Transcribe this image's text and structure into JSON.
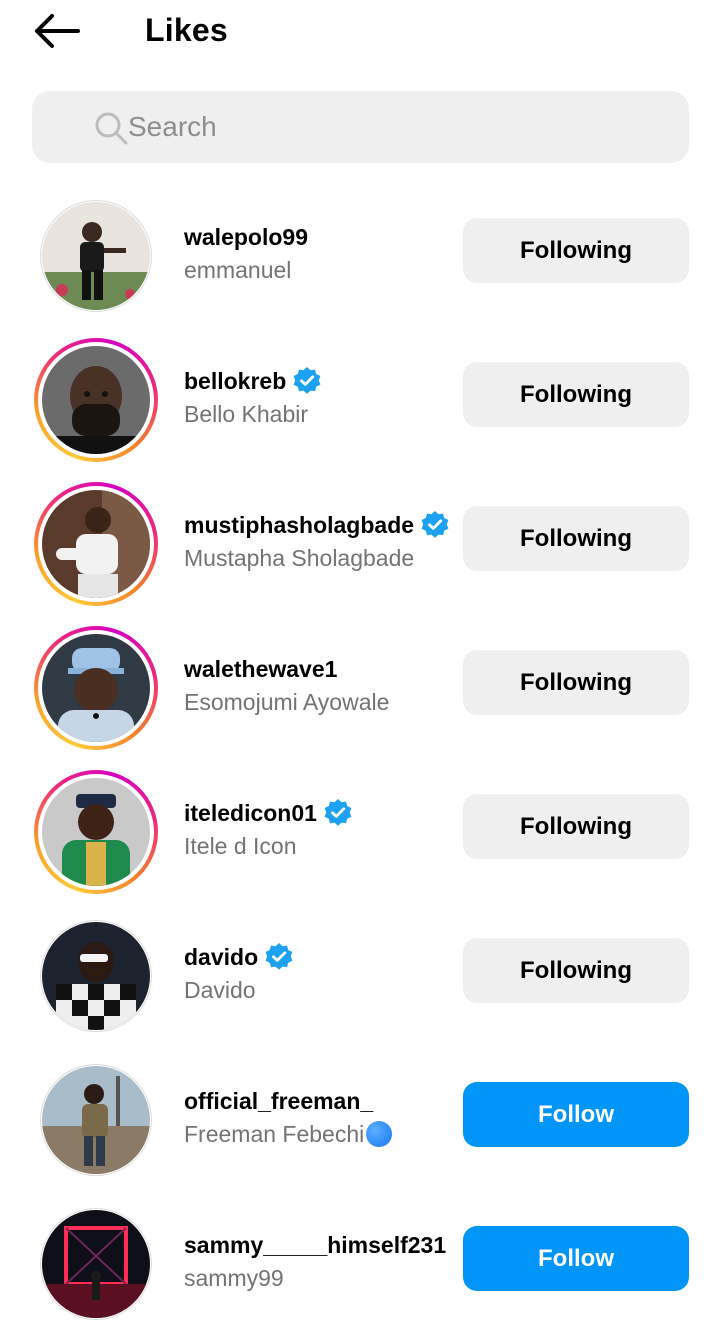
{
  "header": {
    "title": "Likes",
    "back_icon": "arrow-left-icon"
  },
  "search": {
    "placeholder": "Search",
    "icon": "search-icon"
  },
  "colors": {
    "follow_blue": "#0095f6",
    "verified_blue": "#1da1f2",
    "button_gray": "#efefef",
    "secondary_text": "#737373"
  },
  "users": [
    {
      "username": "walepolo99",
      "full_name": "emmanuel",
      "verified": false,
      "story_ring": false,
      "button": "Following"
    },
    {
      "username": "bellokreb",
      "full_name": "Bello Khabir",
      "verified": true,
      "story_ring": true,
      "button": "Following"
    },
    {
      "username": "mustiphasholagbade",
      "full_name": "Mustapha Sholagbade",
      "verified": true,
      "story_ring": true,
      "button": "Following"
    },
    {
      "username": "walethewave1",
      "full_name": "Esomojumi Ayowale",
      "verified": false,
      "story_ring": true,
      "button": "Following"
    },
    {
      "username": "iteledicon01",
      "full_name": "Itele d Icon",
      "verified": true,
      "story_ring": true,
      "button": "Following"
    },
    {
      "username": "davido",
      "full_name": "Davido",
      "verified": true,
      "story_ring": false,
      "button": "Following"
    },
    {
      "username": "official_freeman_",
      "full_name": "Freeman Febechi",
      "verified": false,
      "story_ring": false,
      "button": "Follow"
    },
    {
      "username": "sammy_____himself231",
      "full_name": "sammy99",
      "verified": false,
      "story_ring": false,
      "button": "Follow"
    }
  ]
}
